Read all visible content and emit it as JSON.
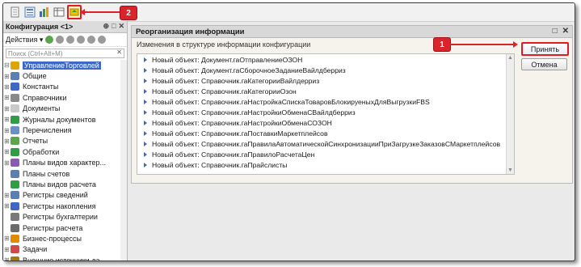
{
  "colors": {
    "accent": "#d9242b",
    "selection": "#3d68c5",
    "window_bg": "#f5f3eb"
  },
  "toolbar": {
    "icons": [
      "document-icon",
      "list-document-icon",
      "configuration-icon",
      "table-icon",
      "update-configuration-icon"
    ]
  },
  "callouts": {
    "one": "1",
    "two": "2"
  },
  "left_panel": {
    "title": "Конфигурация <1>",
    "controls": [
      "⊕",
      "□",
      "✕"
    ],
    "actions_label": "Действия ▾",
    "search_placeholder": "Поиск (Ctrl+Alt+M)",
    "search_clear": "✕",
    "tree": [
      {
        "label": "УправлениеТорговлей",
        "icon": "config-root-icon",
        "expand": "⊟",
        "root": true
      },
      {
        "label": "Общие",
        "icon": "common-icon",
        "expand": "⊞"
      },
      {
        "label": "Константы",
        "icon": "constants-icon",
        "expand": "⊞"
      },
      {
        "label": "Справочники",
        "icon": "catalogs-icon",
        "expand": "⊞"
      },
      {
        "label": "Документы",
        "icon": "documents-icon",
        "expand": "⊞"
      },
      {
        "label": "Журналы документов",
        "icon": "journals-icon",
        "expand": "⊞"
      },
      {
        "label": "Перечисления",
        "icon": "enums-icon",
        "expand": "⊞"
      },
      {
        "label": "Отчеты",
        "icon": "reports-icon",
        "expand": "⊞"
      },
      {
        "label": "Обработки",
        "icon": "dataprocessors-icon",
        "expand": "⊞"
      },
      {
        "label": "Планы видов характер...",
        "icon": "chart-of-characteristics-icon",
        "expand": "⊞"
      },
      {
        "label": "Планы счетов",
        "icon": "chart-of-accounts-icon",
        "expand": ""
      },
      {
        "label": "Планы видов расчета",
        "icon": "calculation-types-icon",
        "expand": ""
      },
      {
        "label": "Регистры сведений",
        "icon": "info-registers-icon",
        "expand": "⊞"
      },
      {
        "label": "Регистры накопления",
        "icon": "accumulation-registers-icon",
        "expand": "⊞"
      },
      {
        "label": "Регистры бухгалтерии",
        "icon": "accounting-registers-icon",
        "expand": ""
      },
      {
        "label": "Регистры расчета",
        "icon": "calculation-registers-icon",
        "expand": ""
      },
      {
        "label": "Бизнес-процессы",
        "icon": "business-processes-icon",
        "expand": "⊞"
      },
      {
        "label": "Задачи",
        "icon": "tasks-icon",
        "expand": "⊞"
      },
      {
        "label": "Внешние источники да...",
        "icon": "external-sources-icon",
        "expand": "⊞"
      }
    ]
  },
  "window": {
    "title": "Реорганизация информации",
    "controls": [
      "□",
      "✕"
    ],
    "subtitle": "Изменения в структуре информации конфигурации",
    "items": [
      "Новый объект: Документ.гаОтправлениеОЗОН",
      "Новый объект: Документ.гаСборочноеЗаданиеВайлдберриз",
      "Новый объект: Справочник.гаКатегорииВайлдерриз",
      "Новый объект: Справочник.гаКатегорииОзон",
      "Новый объект: Справочник.гаНастройкаСпискаТоваровБлокируеныхДляВыгрузкиFBS",
      "Новый объект: Справочник.гаНастройкиОбменаСВайлдберриз",
      "Новый объект: Справочник.гаНастройкиОбменаСОЗОН",
      "Новый объект: Справочник.гаПоставкиМаркетплейсов",
      "Новый объект: Справочник.гаПравилаАвтоматическойСинхронизацииПриЗагрузкеЗаказовСМаркетплейсов",
      "Новый объект: Справочник.гаПравилоРасчетаЦен",
      "Новый объект: Справочник.гаПрайслисты"
    ],
    "accept_label": "Принять",
    "cancel_label": "Отмена"
  }
}
